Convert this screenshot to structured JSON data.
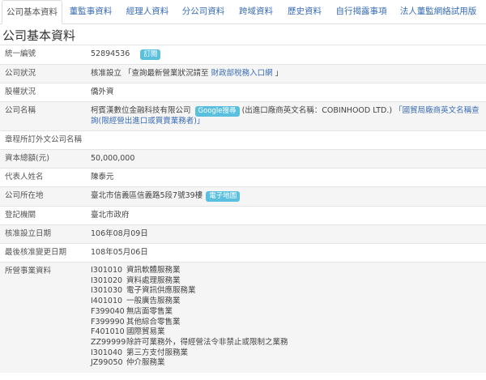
{
  "tabs": [
    {
      "label": "公司基本資料",
      "width": 75,
      "active": true
    },
    {
      "label": "董監事資料",
      "width": 70
    },
    {
      "label": "經理人資料",
      "width": 70
    },
    {
      "label": "分公司資料",
      "width": 68
    },
    {
      "label": "跨域資料",
      "width": 62
    },
    {
      "label": "歷史資料",
      "width": 58
    },
    {
      "label": "自行揭露事項",
      "width": 82
    },
    {
      "label": "法人董監網絡試用版",
      "width": 108
    }
  ],
  "page_title": "公司基本資料",
  "rows": {
    "tax_id": {
      "label": "統一編號",
      "value": "52894536",
      "badge": "訂閱"
    },
    "status": {
      "label": "公司狀況",
      "value": "核准設立",
      "note_prefix": "「查詢最新營業狀況請至",
      "note_link": "財政部稅務入口網",
      "note_suffix": "」"
    },
    "equity": {
      "label": "股權狀況",
      "value": "僑外資"
    },
    "name": {
      "label": "公司名稱",
      "value": "柯賓漢數位金融科技有限公司",
      "google": "Google搜尋",
      "english": "(出進口廠商英文名稱：COBINHOOD LTD.)",
      "link": "「國貿局廠商英文名稱查詢(限經營出進口或買賣業務者)」"
    },
    "foreign_name": {
      "label": "章程所訂外文公司名稱",
      "value": ""
    },
    "capital": {
      "label": "資本總額(元)",
      "value": "50,000,000"
    },
    "rep": {
      "label": "代表人姓名",
      "value": "陳泰元"
    },
    "address": {
      "label": "公司所在地",
      "value": "臺北市信義區信義路5段7號39樓",
      "badge": "電子地圖"
    },
    "authority": {
      "label": "登記機關",
      "value": "臺北市政府"
    },
    "approved": {
      "label": "核准設立日期",
      "value": "106年08月09日"
    },
    "changed": {
      "label": "最後核准變更日期",
      "value": "108年05月06日"
    },
    "business": {
      "label": "所營事業資料",
      "items": [
        {
          "code": "I301010",
          "desc": "資訊軟體服務業"
        },
        {
          "code": "I301020",
          "desc": "資料處理服務業"
        },
        {
          "code": "I301030",
          "desc": "電子資訊供應服務業"
        },
        {
          "code": "I401010",
          "desc": "一般廣告服務業"
        },
        {
          "code": "F399040",
          "desc": "無店面零售業"
        },
        {
          "code": "F399990",
          "desc": "其他綜合零售業"
        },
        {
          "code": "F401010",
          "desc": "國際貿易業"
        },
        {
          "code": "ZZ99999",
          "desc": "除許可業務外，得經營法令非禁止或限制之業務"
        },
        {
          "code": "I301040",
          "desc": "第三方支付服務業"
        },
        {
          "code": "JZ99050",
          "desc": "仲介服務業"
        }
      ]
    }
  }
}
